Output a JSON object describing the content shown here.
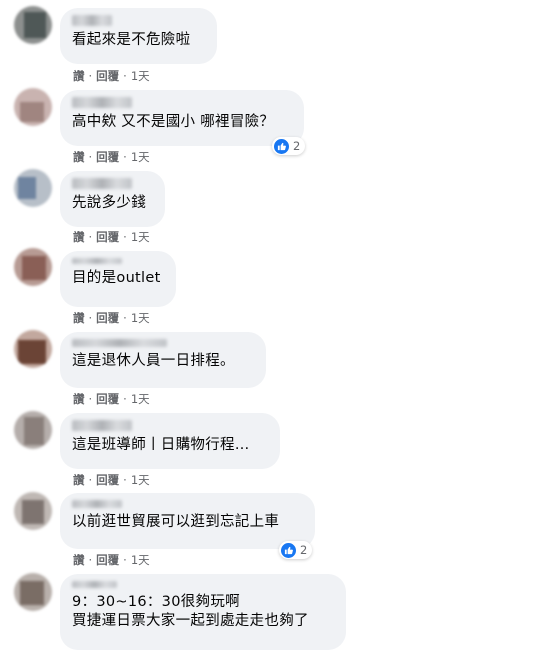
{
  "actions": {
    "like": "讚",
    "reply": "回覆",
    "dot": "·"
  },
  "comments": [
    {
      "text": "看起來是不危險啦",
      "time": "1天"
    },
    {
      "text": "高中欸 又不是國小 哪裡冒險？",
      "time": "1天",
      "reactions": "2"
    },
    {
      "text": "先說多少錢",
      "time": "1天"
    },
    {
      "text": "目的是outlet",
      "time": "1天"
    },
    {
      "text": "這是退休人員一日排程。",
      "time": "1天"
    },
    {
      "text": "這是班導師丨日購物行程…",
      "time": "1天"
    },
    {
      "text": "以前逛世貿展可以逛到忘記上車",
      "time": "1天",
      "reactions": "2"
    },
    {
      "text": "9：30~16：30很夠玩啊\n買捷運日票大家一起到處走走也夠了"
    }
  ],
  "colors": {
    "bubble": "#f0f2f5",
    "meta": "#65676b",
    "like": "#1877f2"
  }
}
